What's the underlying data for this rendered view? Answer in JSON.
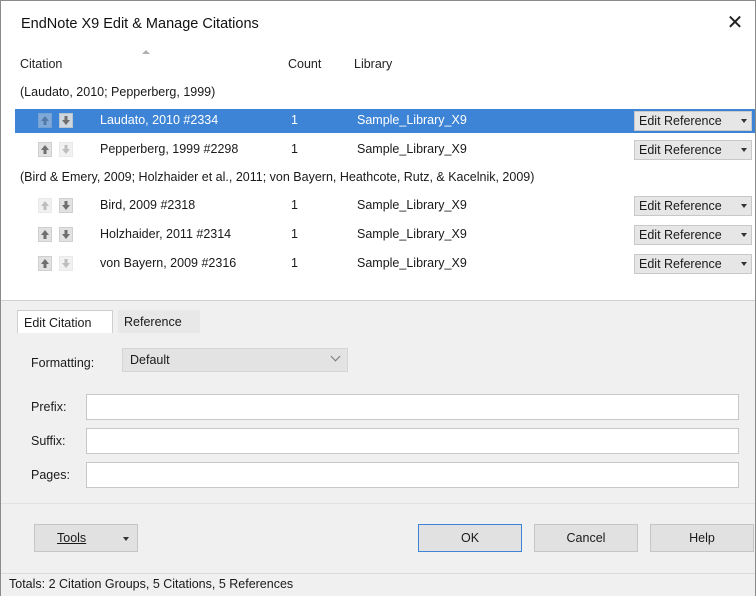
{
  "window": {
    "title": "EndNote X9 Edit & Manage Citations",
    "close_icon": "close-icon"
  },
  "columns": {
    "citation": "Citation",
    "count": "Count",
    "library": "Library"
  },
  "groups": [
    {
      "label": "(Laudato, 2010; Pepperberg, 1999)",
      "rows": [
        {
          "citation": "Laudato, 2010 #2334",
          "count": "1",
          "library": "Sample_Library_X9",
          "action": "Edit Reference",
          "selected": true
        },
        {
          "citation": "Pepperberg, 1999 #2298",
          "count": "1",
          "library": "Sample_Library_X9",
          "action": "Edit Reference",
          "selected": false
        }
      ]
    },
    {
      "label": "(Bird & Emery, 2009; Holzhaider et al., 2011; von Bayern, Heathcote, Rutz, & Kacelnik, 2009)",
      "rows": [
        {
          "citation": "Bird, 2009 #2318",
          "count": "1",
          "library": "Sample_Library_X9",
          "action": "Edit Reference",
          "selected": false
        },
        {
          "citation": "Holzhaider, 2011 #2314",
          "count": "1",
          "library": "Sample_Library_X9",
          "action": "Edit Reference",
          "selected": false
        },
        {
          "citation": "von Bayern, 2009 #2316",
          "count": "1",
          "library": "Sample_Library_X9",
          "action": "Edit Reference",
          "selected": false
        }
      ]
    }
  ],
  "tabs": {
    "edit_citation": "Edit Citation",
    "reference": "Reference"
  },
  "edit_citation": {
    "formatting_label": "Formatting:",
    "formatting_value": "Default",
    "prefix_label": "Prefix:",
    "prefix_value": "",
    "suffix_label": "Suffix:",
    "suffix_value": "",
    "pages_label": "Pages:",
    "pages_value": ""
  },
  "buttons": {
    "tools": "Tools",
    "ok": "OK",
    "cancel": "Cancel",
    "help": "Help"
  },
  "status": "Totals: 2 Citation Groups, 5 Citations, 5 References",
  "colors": {
    "selection": "#3d84d6",
    "panel": "#f0f0f0"
  }
}
